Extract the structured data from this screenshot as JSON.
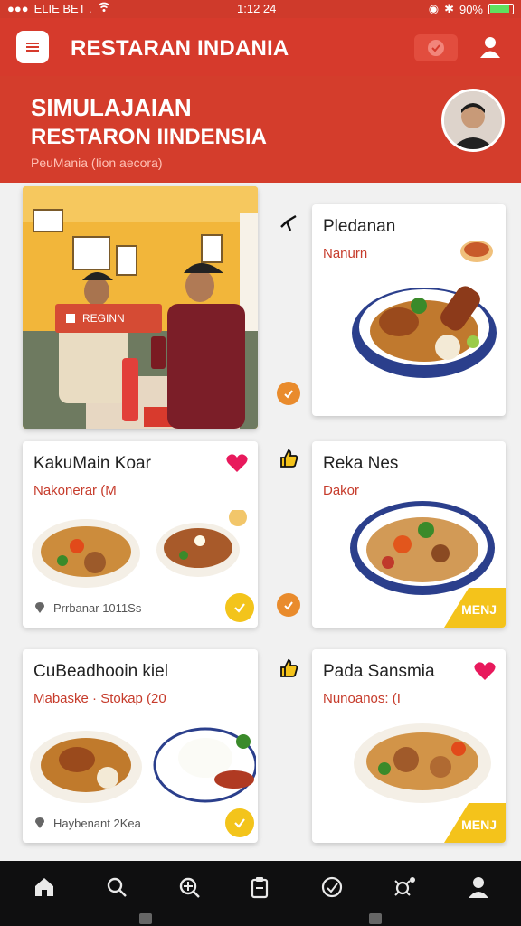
{
  "status_bar": {
    "carrier": "ELIE BET .",
    "time": "1:12 24",
    "battery": "90%"
  },
  "app_bar": {
    "title": "RESTARAN INDANIA"
  },
  "hero": {
    "title_line1": "SIMULAJAIAN",
    "title_line2": "RESTARON IINDENSIA",
    "subtitle": "PeuMania (Iion aecora)"
  },
  "photo_card": {
    "tag_label": "REGINN"
  },
  "cards": [
    {
      "title": "Pledanan",
      "subtitle": "Nanurn",
      "meta": ""
    },
    {
      "title": "KakuMain Koar",
      "subtitle": "Nakonerar (M",
      "meta": "Prrbanar 1011Ss"
    },
    {
      "title": "Reka Nes",
      "subtitle": "Dakor",
      "meta": "",
      "corner_label": "MENJ"
    },
    {
      "title": "CuBeadhooin kiel",
      "subtitle": "Mabaske · Stokap (20",
      "meta": "Haybenant 2Kea"
    },
    {
      "title": "Pada Sansmia",
      "subtitle": "Nunoanos: (I",
      "meta": "",
      "corner_label": "MENJ"
    }
  ],
  "colors": {
    "primary_red": "#d63a2c",
    "accent_yellow": "#f4c31b",
    "accent_orange": "#e98b2c",
    "heart_pink": "#e8195c"
  },
  "bottom_nav": {
    "items": [
      "home-icon",
      "search-icon",
      "explore-icon",
      "clipboard-icon",
      "dish-icon",
      "settings-icon",
      "profile-icon"
    ]
  }
}
